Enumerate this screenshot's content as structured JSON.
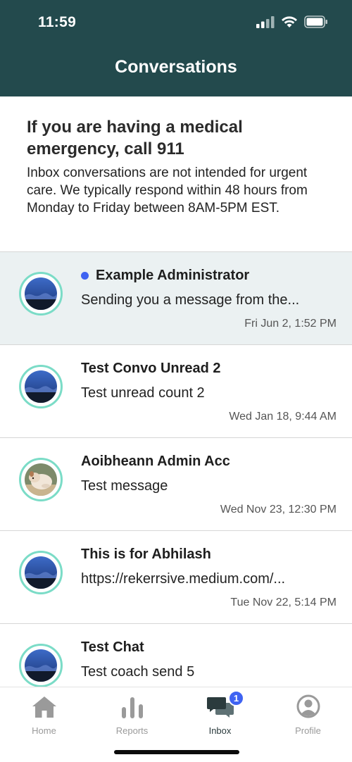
{
  "status_bar": {
    "time": "11:59"
  },
  "header": {
    "title": "Conversations"
  },
  "notice": {
    "title": "If you are having a medical emergency, call 911",
    "body": "Inbox conversations are not intended for urgent care. We typically respond within 48 hours from Monday to Friday between 8AM-5PM EST."
  },
  "conversations": [
    {
      "name": "Example Administrator",
      "preview": "Sending you a message from the...",
      "time": "Fri Jun 2, 1:52 PM",
      "unread": true,
      "avatar": "landscape-photo"
    },
    {
      "name": "Test Convo Unread 2",
      "preview": "Test unread count 2",
      "time": "Wed Jan 18, 9:44 AM",
      "unread": false,
      "avatar": "landscape-photo"
    },
    {
      "name": "Aoibheann Admin Acc",
      "preview": "Test message",
      "time": "Wed Nov 23, 12:30 PM",
      "unread": false,
      "avatar": "dog-photo"
    },
    {
      "name": "This is for Abhilash",
      "preview": "https://rekerrsive.medium.com/...",
      "time": "Tue Nov 22, 5:14 PM",
      "unread": false,
      "avatar": "landscape-photo"
    },
    {
      "name": "Test Chat",
      "preview": "Test coach send 5",
      "time": "",
      "unread": false,
      "avatar": "landscape-photo"
    }
  ],
  "tabbar": {
    "home": "Home",
    "reports": "Reports",
    "inbox": "Inbox",
    "inbox_badge": "1",
    "profile": "Profile"
  },
  "colors": {
    "header_bg": "#234a4d",
    "accent_ring": "#7bdcc7",
    "unread_dot": "#3f63f2",
    "unread_row_bg": "#ebf1f2"
  }
}
